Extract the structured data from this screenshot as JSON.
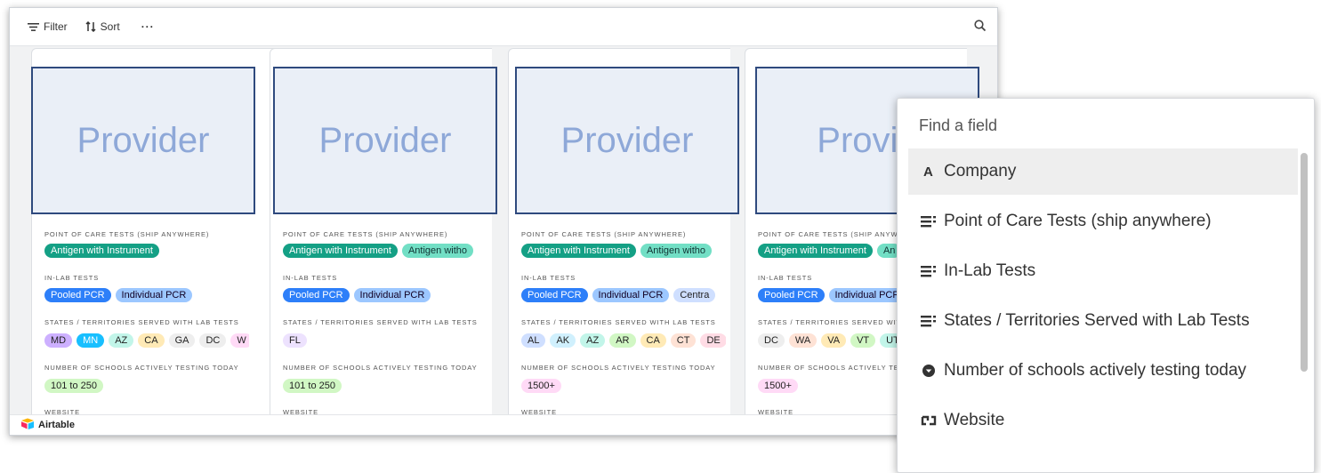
{
  "toolbar": {
    "filter_label": "Filter",
    "sort_label": "Sort",
    "more_label": "···"
  },
  "cards": [
    {
      "cover_text": "Provider",
      "poc_label": "POINT OF CARE TESTS (SHIP ANYWHERE)",
      "poc_tags": [
        "Antigen with Instrument"
      ],
      "lab_label": "IN-LAB TESTS",
      "lab_tags": [
        "Pooled PCR",
        "Individual PCR"
      ],
      "states_label": "STATES / TERRITORIES SERVED WITH LAB TESTS",
      "states": [
        "MD",
        "MN",
        "AZ",
        "CA",
        "GA",
        "DC",
        "W"
      ],
      "schools_label": "NUMBER OF SCHOOLS ACTIVELY TESTING TODAY",
      "schools": "101 to 250",
      "website_label": "WEBSITE"
    },
    {
      "cover_text": "Provider",
      "poc_label": "POINT OF CARE TESTS (SHIP ANYWHERE)",
      "poc_tags": [
        "Antigen with Instrument",
        "Antigen witho"
      ],
      "lab_label": "IN-LAB TESTS",
      "lab_tags": [
        "Pooled PCR",
        "Individual PCR"
      ],
      "states_label": "STATES / TERRITORIES SERVED WITH LAB TESTS",
      "states": [
        "FL"
      ],
      "schools_label": "NUMBER OF SCHOOLS ACTIVELY TESTING TODAY",
      "schools": "101 to 250",
      "website_label": "WEBSITE"
    },
    {
      "cover_text": "Provider",
      "poc_label": "POINT OF CARE TESTS (SHIP ANYWHERE)",
      "poc_tags": [
        "Antigen with Instrument",
        "Antigen witho"
      ],
      "lab_label": "IN-LAB TESTS",
      "lab_tags": [
        "Pooled PCR",
        "Individual PCR",
        "Centra"
      ],
      "states_label": "STATES / TERRITORIES SERVED WITH LAB TESTS",
      "states": [
        "AL",
        "AK",
        "AZ",
        "AR",
        "CA",
        "CT",
        "DE"
      ],
      "schools_label": "NUMBER OF SCHOOLS ACTIVELY TESTING TODAY",
      "schools": "1500+",
      "website_label": "WEBSITE"
    },
    {
      "cover_text": "Provid",
      "poc_label": "POINT OF CARE TESTS (SHIP ANYWHERE)",
      "poc_tags": [
        "Antigen with Instrument",
        "An"
      ],
      "lab_label": "IN-LAB TESTS",
      "lab_tags": [
        "Pooled PCR",
        "Individual PCR"
      ],
      "states_label": "STATES / TERRITORIES SERVED WITH LAB TESTS",
      "states": [
        "DC",
        "WA",
        "VA",
        "VT",
        "UT"
      ],
      "schools_label": "NUMBER OF SCHOOLS ACTIVELY TESTING TODAY",
      "schools": "1500+",
      "website_label": "WEBSITE"
    }
  ],
  "footer": {
    "brand": "Airtable"
  },
  "picker": {
    "placeholder": "Find a field",
    "items": [
      {
        "label": "Company",
        "icon": "text-icon"
      },
      {
        "label": "Point of Care Tests (ship anywhere)",
        "icon": "multi-select-icon"
      },
      {
        "label": "In-Lab Tests",
        "icon": "multi-select-icon"
      },
      {
        "label": "States / Territories Served with Lab Tests",
        "icon": "multi-select-icon"
      },
      {
        "label": "Number of schools actively testing today",
        "icon": "single-select-icon"
      },
      {
        "label": "Website",
        "icon": "url-icon"
      }
    ]
  },
  "colors": {
    "teal": "#14a085",
    "teal_light": "#72dfc5",
    "blue": "#2d7ff9",
    "blue_light": "#9cc7ff",
    "cover_border": "#2f4a7e",
    "cover_text": "#8ea8d8"
  }
}
